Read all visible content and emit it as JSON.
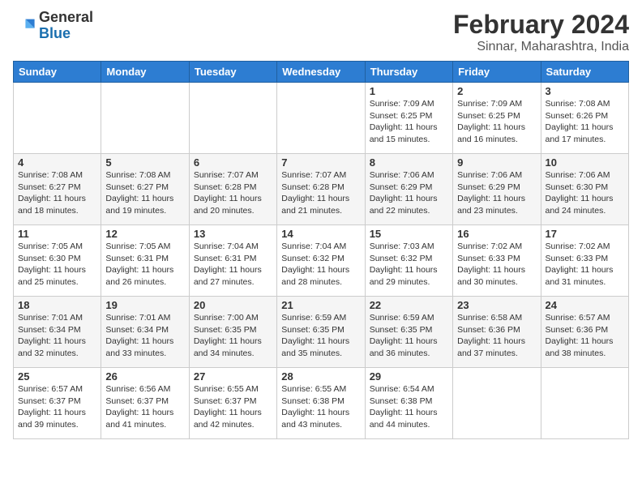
{
  "logo": {
    "line1": "General",
    "line2": "Blue"
  },
  "title": "February 2024",
  "subtitle": "Sinnar, Maharashtra, India",
  "weekdays": [
    "Sunday",
    "Monday",
    "Tuesday",
    "Wednesday",
    "Thursday",
    "Friday",
    "Saturday"
  ],
  "weeks": [
    [
      {
        "day": "",
        "info": ""
      },
      {
        "day": "",
        "info": ""
      },
      {
        "day": "",
        "info": ""
      },
      {
        "day": "",
        "info": ""
      },
      {
        "day": "1",
        "info": "Sunrise: 7:09 AM\nSunset: 6:25 PM\nDaylight: 11 hours\nand 15 minutes."
      },
      {
        "day": "2",
        "info": "Sunrise: 7:09 AM\nSunset: 6:25 PM\nDaylight: 11 hours\nand 16 minutes."
      },
      {
        "day": "3",
        "info": "Sunrise: 7:08 AM\nSunset: 6:26 PM\nDaylight: 11 hours\nand 17 minutes."
      }
    ],
    [
      {
        "day": "4",
        "info": "Sunrise: 7:08 AM\nSunset: 6:27 PM\nDaylight: 11 hours\nand 18 minutes."
      },
      {
        "day": "5",
        "info": "Sunrise: 7:08 AM\nSunset: 6:27 PM\nDaylight: 11 hours\nand 19 minutes."
      },
      {
        "day": "6",
        "info": "Sunrise: 7:07 AM\nSunset: 6:28 PM\nDaylight: 11 hours\nand 20 minutes."
      },
      {
        "day": "7",
        "info": "Sunrise: 7:07 AM\nSunset: 6:28 PM\nDaylight: 11 hours\nand 21 minutes."
      },
      {
        "day": "8",
        "info": "Sunrise: 7:06 AM\nSunset: 6:29 PM\nDaylight: 11 hours\nand 22 minutes."
      },
      {
        "day": "9",
        "info": "Sunrise: 7:06 AM\nSunset: 6:29 PM\nDaylight: 11 hours\nand 23 minutes."
      },
      {
        "day": "10",
        "info": "Sunrise: 7:06 AM\nSunset: 6:30 PM\nDaylight: 11 hours\nand 24 minutes."
      }
    ],
    [
      {
        "day": "11",
        "info": "Sunrise: 7:05 AM\nSunset: 6:30 PM\nDaylight: 11 hours\nand 25 minutes."
      },
      {
        "day": "12",
        "info": "Sunrise: 7:05 AM\nSunset: 6:31 PM\nDaylight: 11 hours\nand 26 minutes."
      },
      {
        "day": "13",
        "info": "Sunrise: 7:04 AM\nSunset: 6:31 PM\nDaylight: 11 hours\nand 27 minutes."
      },
      {
        "day": "14",
        "info": "Sunrise: 7:04 AM\nSunset: 6:32 PM\nDaylight: 11 hours\nand 28 minutes."
      },
      {
        "day": "15",
        "info": "Sunrise: 7:03 AM\nSunset: 6:32 PM\nDaylight: 11 hours\nand 29 minutes."
      },
      {
        "day": "16",
        "info": "Sunrise: 7:02 AM\nSunset: 6:33 PM\nDaylight: 11 hours\nand 30 minutes."
      },
      {
        "day": "17",
        "info": "Sunrise: 7:02 AM\nSunset: 6:33 PM\nDaylight: 11 hours\nand 31 minutes."
      }
    ],
    [
      {
        "day": "18",
        "info": "Sunrise: 7:01 AM\nSunset: 6:34 PM\nDaylight: 11 hours\nand 32 minutes."
      },
      {
        "day": "19",
        "info": "Sunrise: 7:01 AM\nSunset: 6:34 PM\nDaylight: 11 hours\nand 33 minutes."
      },
      {
        "day": "20",
        "info": "Sunrise: 7:00 AM\nSunset: 6:35 PM\nDaylight: 11 hours\nand 34 minutes."
      },
      {
        "day": "21",
        "info": "Sunrise: 6:59 AM\nSunset: 6:35 PM\nDaylight: 11 hours\nand 35 minutes."
      },
      {
        "day": "22",
        "info": "Sunrise: 6:59 AM\nSunset: 6:35 PM\nDaylight: 11 hours\nand 36 minutes."
      },
      {
        "day": "23",
        "info": "Sunrise: 6:58 AM\nSunset: 6:36 PM\nDaylight: 11 hours\nand 37 minutes."
      },
      {
        "day": "24",
        "info": "Sunrise: 6:57 AM\nSunset: 6:36 PM\nDaylight: 11 hours\nand 38 minutes."
      }
    ],
    [
      {
        "day": "25",
        "info": "Sunrise: 6:57 AM\nSunset: 6:37 PM\nDaylight: 11 hours\nand 39 minutes."
      },
      {
        "day": "26",
        "info": "Sunrise: 6:56 AM\nSunset: 6:37 PM\nDaylight: 11 hours\nand 41 minutes."
      },
      {
        "day": "27",
        "info": "Sunrise: 6:55 AM\nSunset: 6:37 PM\nDaylight: 11 hours\nand 42 minutes."
      },
      {
        "day": "28",
        "info": "Sunrise: 6:55 AM\nSunset: 6:38 PM\nDaylight: 11 hours\nand 43 minutes."
      },
      {
        "day": "29",
        "info": "Sunrise: 6:54 AM\nSunset: 6:38 PM\nDaylight: 11 hours\nand 44 minutes."
      },
      {
        "day": "",
        "info": ""
      },
      {
        "day": "",
        "info": ""
      }
    ]
  ]
}
